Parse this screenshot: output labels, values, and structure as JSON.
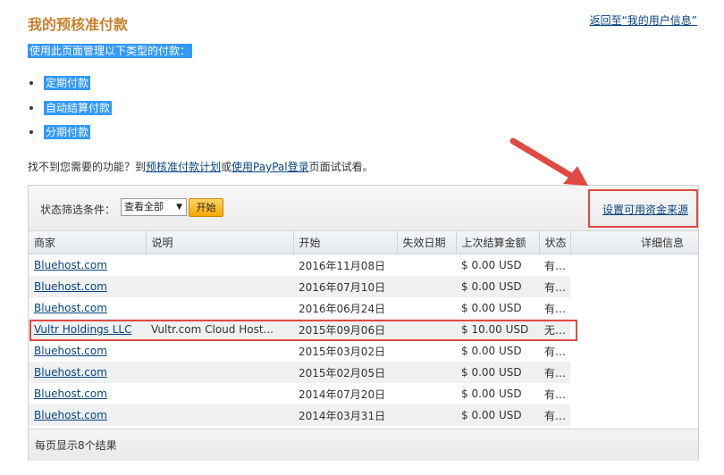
{
  "page": {
    "title": "我的预核准付款",
    "back_link": "返回至“我的用户信息”",
    "intro": "使用此页面管理以下类型的付款：",
    "types": [
      "定期付款",
      "自动结算付款",
      "分期付款"
    ],
    "help": {
      "prefix": "找不到您需要的功能？到",
      "link1": "预核准付款计划",
      "middle": "或",
      "link2": "使用PayPal登录",
      "suffix": "页面试试看。"
    }
  },
  "filter": {
    "label": "状态筛选条件：",
    "selected": "查看全部",
    "go": "开始",
    "funding_link": "设置可用资金来源"
  },
  "table": {
    "headers": [
      "商家",
      "说明",
      "开始",
      "失效日期",
      "上次结算金额",
      "状态",
      "详细信息"
    ],
    "rows": [
      {
        "merchant": "Bluehost.com",
        "desc": "",
        "start": "2016年11月08日",
        "expiry": "",
        "amount": "$ 0.00 USD",
        "status": "有效"
      },
      {
        "merchant": "Bluehost.com",
        "desc": "",
        "start": "2016年07月10日",
        "expiry": "",
        "amount": "$ 0.00 USD",
        "status": "有效"
      },
      {
        "merchant": "Bluehost.com",
        "desc": "",
        "start": "2016年06月24日",
        "expiry": "",
        "amount": "$ 0.00 USD",
        "status": "有效"
      },
      {
        "merchant": "Vultr Holdings LLC",
        "desc": "Vultr.com Cloud Host...",
        "start": "2015年09月06日",
        "expiry": "",
        "amount": "$ 10.00 USD",
        "status": "无效"
      },
      {
        "merchant": "Bluehost.com",
        "desc": "",
        "start": "2015年03月02日",
        "expiry": "",
        "amount": "$ 0.00 USD",
        "status": "有效"
      },
      {
        "merchant": "Bluehost.com",
        "desc": "",
        "start": "2015年02月05日",
        "expiry": "",
        "amount": "$ 0.00 USD",
        "status": "有效"
      },
      {
        "merchant": "Bluehost.com",
        "desc": "",
        "start": "2014年07月20日",
        "expiry": "",
        "amount": "$ 0.00 USD",
        "status": "有效"
      },
      {
        "merchant": "Bluehost.com",
        "desc": "",
        "start": "2014年03月31日",
        "expiry": "",
        "amount": "$ 0.00 USD",
        "status": "有效"
      }
    ],
    "footer": "每页显示8个结果"
  },
  "colors": {
    "title": "#c7802e",
    "link": "#084482",
    "highlight": "#3399ff",
    "annotation": "#e04a42",
    "button": "#f5a800"
  },
  "icons": {
    "select_caret": "caret-down-icon",
    "annotation_arrow": "red-arrow-icon"
  }
}
